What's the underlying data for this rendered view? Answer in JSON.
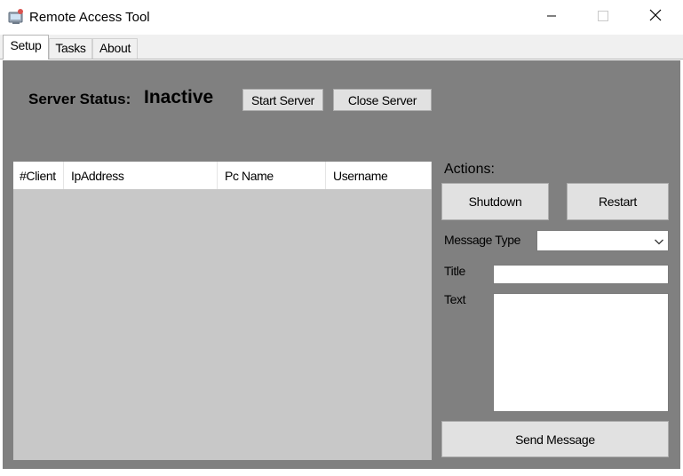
{
  "window": {
    "title": "Remote Access Tool",
    "icon": "remote-computer-icon",
    "controls": {
      "minimize_icon": "minimize-icon",
      "maximize_icon": "maximize-icon",
      "close_icon": "close-icon"
    }
  },
  "tabs": [
    {
      "label": "Setup",
      "active": true
    },
    {
      "label": "Tasks",
      "active": false
    },
    {
      "label": "About",
      "active": false
    }
  ],
  "server": {
    "status_label": "Server Status:",
    "status_value": "Inactive",
    "start_label": "Start Server",
    "close_label": "Close Server"
  },
  "clients": {
    "columns": [
      "#Client",
      "IpAddress",
      "Pc Name",
      "Username"
    ],
    "rows": []
  },
  "actions": {
    "label": "Actions:",
    "shutdown_label": "Shutdown",
    "restart_label": "Restart"
  },
  "message": {
    "type_label": "Message Type",
    "type_value": "",
    "title_label": "Title",
    "title_value": "",
    "text_label": "Text",
    "text_value": "",
    "send_label": "Send Message"
  },
  "colors": {
    "panel_background": "#808080",
    "list_background": "#c8c8c8",
    "button_face": "#e1e1e1",
    "tab_strip": "#f0f0f0"
  }
}
